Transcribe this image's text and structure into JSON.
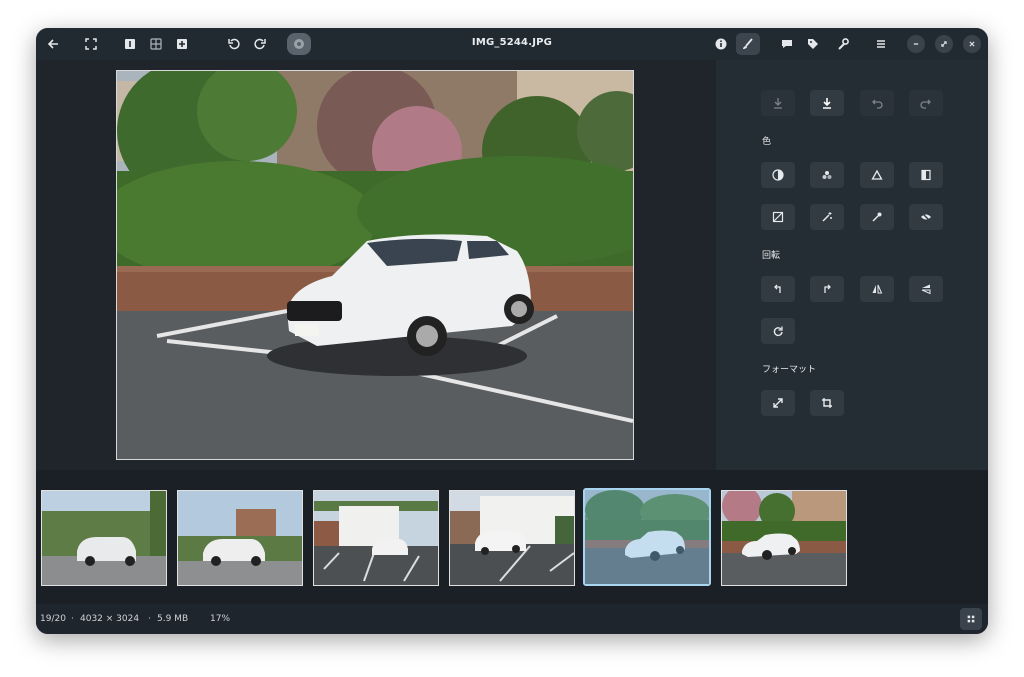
{
  "window": {
    "title": "IMG_5244.JPG"
  },
  "headerbar": {
    "left_icons": [
      "back-arrow-icon",
      "fullscreen-icon",
      "single-view-icon",
      "grid-view-icon",
      "add-icon",
      "rotate-left-icon",
      "rotate-right-icon",
      "album-icon"
    ],
    "right_icons": [
      "info-icon",
      "edit-brush-icon",
      "comment-icon",
      "tag-icon",
      "wrench-icon",
      "menu-icon",
      "minimize-icon",
      "restore-icon",
      "close-icon"
    ]
  },
  "sidebar": {
    "sections": {
      "color": "色",
      "rotate": "回転",
      "format": "フォーマット"
    }
  },
  "filmstrip": {
    "selected_index": 4,
    "count": 6
  },
  "status": {
    "position": "19/20",
    "dimensions": "4032 × 3024",
    "size": "5.9 MB",
    "zoom": "17%",
    "sep": "·"
  },
  "colors": {
    "accent": "#a8d4f0",
    "window": "#1e252c",
    "sidebar": "#252d34"
  }
}
